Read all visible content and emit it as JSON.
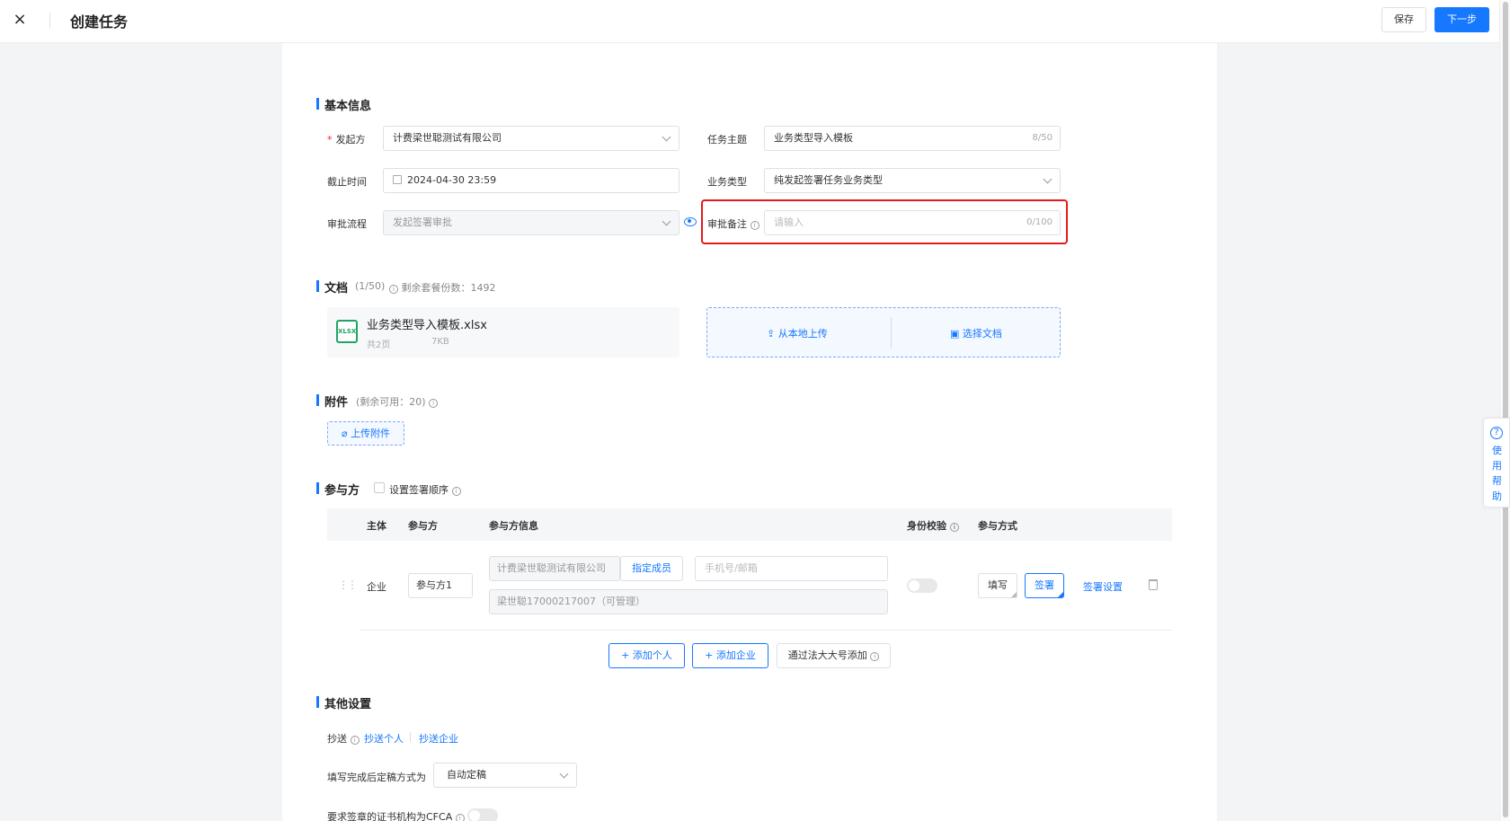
{
  "header": {
    "close_icon": "×",
    "title": "创建任务",
    "save_label": "保存",
    "next_label": "下一步"
  },
  "basic": {
    "section_title": "基本信息",
    "initiator_label": "发起方",
    "initiator_required_mark": "*",
    "initiator_value": "计费梁世聪测试有限公司",
    "subject_label": "任务主题",
    "subject_value": "业务类型导入模板",
    "subject_count": "8/50",
    "deadline_label": "截止时间",
    "deadline_value": "2024-04-30 23:59",
    "biztype_label": "业务类型",
    "biztype_value": "纯发起签署任务业务类型",
    "approval_label": "审批流程",
    "approval_value": "发起签署审批",
    "remark_label": "审批备注",
    "remark_placeholder": "请输入",
    "remark_count": "0/100"
  },
  "documents": {
    "section_title": "文档",
    "count": "(1/50)",
    "remaining": "剩余套餐份数：1492",
    "file_name": "业务类型导入模板.xlsx",
    "file_type": "XLSX",
    "file_pages": "共2页",
    "file_size": "7KB",
    "upload_local": "从本地上传",
    "choose_doc": "选择文档"
  },
  "attachments": {
    "section_title": "附件",
    "remaining": "(剩余可用：20)",
    "upload_label": "上传附件"
  },
  "participants": {
    "section_title": "参与方",
    "order_label": "设置签署顺序",
    "columns": [
      "主体",
      "参与方",
      "参与方信息",
      "身份校验",
      "参与方式"
    ],
    "rows": [
      {
        "entity": "企业",
        "name": "参与方1",
        "company": "计费梁世聪测试有限公司",
        "assign_member": "指定成员",
        "contact_placeholder": "手机号/邮箱",
        "member": "梁世聪17000217007（可管理）",
        "mode_fill": "填写",
        "mode_sign": "签署",
        "sign_settings": "签署设置"
      }
    ],
    "add_person": "添加个人",
    "add_company": "添加企业",
    "add_by_number": "通过法大大号添加"
  },
  "other": {
    "section_title": "其他设置",
    "cc_label": "抄送",
    "cc_person": "抄送个人",
    "cc_company": "抄送企业",
    "finalize_label": "填写完成后定稿方式为",
    "finalize_value": "自动定稿",
    "cfca_label": "要求签章的证书机构为CFCA"
  },
  "help": {
    "icon": "?",
    "label": "使用帮助"
  },
  "colors": {
    "primary": "#1677ff",
    "highlight_border": "#e21b1b",
    "excel_green": "#21a366"
  }
}
